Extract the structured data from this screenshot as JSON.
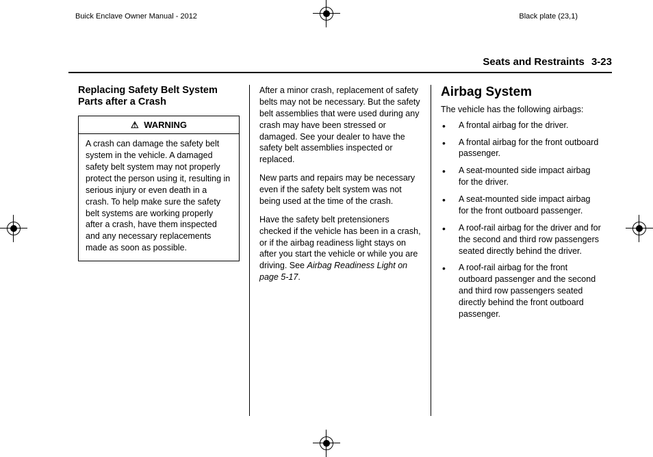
{
  "top": {
    "left": "Buick Enclave Owner Manual - 2012",
    "right": "Black plate (23,1)"
  },
  "header": {
    "chapter": "Seats and Restraints",
    "page": "3-23"
  },
  "col1": {
    "heading": "Replacing Safety Belt System Parts after a Crash",
    "warning_label": "WARNING",
    "warning_body": "A crash can damage the safety belt system in the vehicle. A damaged safety belt system may not properly protect the person using it, resulting in serious injury or even death in a crash. To help make sure the safety belt systems are working properly after a crash, have them inspected and any necessary replacements made as soon as possible."
  },
  "col2": {
    "p1": "After a minor crash, replacement of safety belts may not be necessary. But the safety belt assemblies that were used during any crash may have been stressed or damaged. See your dealer to have the safety belt assemblies inspected or replaced.",
    "p2": "New parts and repairs may be necessary even if the safety belt system was not being used at the time of the crash.",
    "p3a": "Have the safety belt pretensioners checked if the vehicle has been in a crash, or if the airbag readiness light stays on after you start the vehicle or while you are driving. See ",
    "p3b": "Airbag Readiness Light on page 5‑17",
    "p3c": "."
  },
  "col3": {
    "heading": "Airbag System",
    "intro": "The vehicle has the following airbags:",
    "items": [
      "A frontal airbag for the driver.",
      "A frontal airbag for the front outboard passenger.",
      "A seat-mounted side impact airbag for the driver.",
      "A seat-mounted side impact airbag for the front outboard passenger.",
      "A roof-rail airbag for the driver and for the second and third row passengers seated directly behind the driver.",
      "A roof-rail airbag for the front outboard passenger and the second and third row passengers seated directly behind the front outboard passenger."
    ]
  }
}
